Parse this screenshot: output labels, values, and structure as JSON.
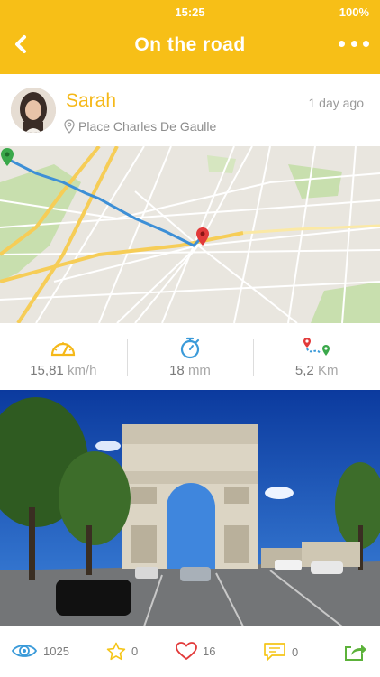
{
  "status": {
    "time": "15:25",
    "battery": "100%"
  },
  "header": {
    "title": "On the road"
  },
  "post": {
    "name": "Sarah",
    "place": "Place Charles De Gaulle",
    "time_ago": "1 day ago"
  },
  "stats": {
    "speed": {
      "value": "15,81",
      "unit": "km/h"
    },
    "duration": {
      "value": "18",
      "unit": "mm"
    },
    "distance": {
      "value": "5,2",
      "unit": "Km"
    }
  },
  "footer": {
    "views": "1025",
    "stars": "0",
    "likes": "16",
    "comments": "0"
  },
  "colors": {
    "accent": "#f7bf17",
    "route": "#3d8fd6"
  }
}
